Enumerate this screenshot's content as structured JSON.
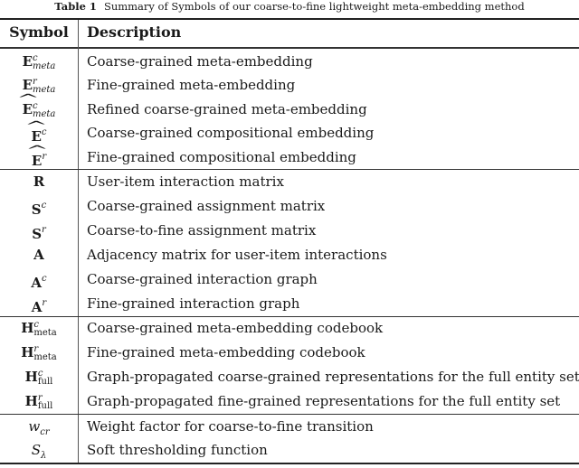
{
  "caption": {
    "label": "Table 1",
    "text": "Summary of Symbols of our coarse-to-fine lightweight meta-embedding method"
  },
  "header": {
    "symbol": "Symbol",
    "description": "Description"
  },
  "groups": [
    {
      "rows": [
        {
          "base": "E",
          "hat": false,
          "sup": "c",
          "sub": "meta",
          "sub_italic": true,
          "description": "Coarse-grained meta-embedding"
        },
        {
          "base": "E",
          "hat": false,
          "sup": "r",
          "sub": "meta",
          "sub_italic": true,
          "description": "Fine-grained meta-embedding"
        },
        {
          "base": "E",
          "hat": true,
          "sup": "c",
          "sub": "meta",
          "sub_italic": true,
          "description": "Refined coarse-grained meta-embedding"
        },
        {
          "base": "E",
          "hat": true,
          "sup": "c",
          "sub": "",
          "sub_italic": false,
          "description": "Coarse-grained compositional embedding"
        },
        {
          "base": "E",
          "hat": true,
          "sup": "r",
          "sub": "",
          "sub_italic": false,
          "description": "Fine-grained compositional embedding"
        }
      ]
    },
    {
      "rows": [
        {
          "base": "R",
          "sup": "",
          "sub": "",
          "description": "User-item interaction matrix"
        },
        {
          "base": "S",
          "sup": "c",
          "sub": "",
          "description": "Coarse-grained assignment matrix"
        },
        {
          "base": "S",
          "sup": "r",
          "sub": "",
          "description": "Coarse-to-fine assignment matrix"
        },
        {
          "base": "A",
          "sup": "",
          "sub": "",
          "description": "Adjacency matrix for user-item interactions"
        },
        {
          "base": "A",
          "sup": "c",
          "sub": "",
          "description": "Coarse-grained interaction graph"
        },
        {
          "base": "A",
          "sup": "r",
          "sub": "",
          "description": "Fine-grained interaction graph"
        }
      ]
    },
    {
      "rows": [
        {
          "base": "H",
          "sup": "c",
          "sub": "meta",
          "description": "Coarse-grained meta-embedding codebook"
        },
        {
          "base": "H",
          "sup": "r",
          "sub": "meta",
          "description": "Fine-grained meta-embedding codebook"
        },
        {
          "base": "H",
          "sup": "c",
          "sub": "full",
          "description": "Graph-propagated coarse-grained representations for the full entity set"
        },
        {
          "base": "H",
          "sup": "r",
          "sub": "full",
          "description": "Graph-propagated fine-grained representations for the full entity set"
        }
      ]
    },
    {
      "rows": [
        {
          "base": "w",
          "sub": "cr",
          "description": "Weight factor for coarse-to-fine transition"
        },
        {
          "base": "S",
          "sub": "λ",
          "description": "Soft thresholding function"
        }
      ]
    }
  ]
}
